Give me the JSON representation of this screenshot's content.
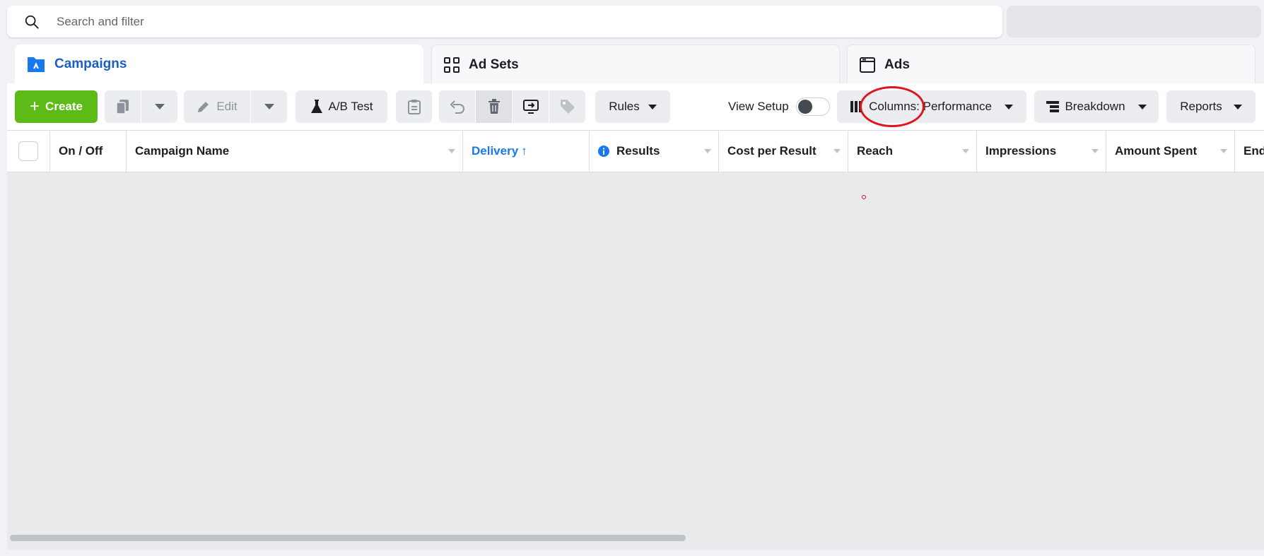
{
  "search": {
    "placeholder": "Search and filter"
  },
  "tabs": [
    {
      "label": "Campaigns",
      "icon": "campaign-folder-icon"
    },
    {
      "label": "Ad Sets",
      "icon": "grid-icon"
    },
    {
      "label": "Ads",
      "icon": "ad-window-icon"
    }
  ],
  "toolbar": {
    "create_label": "Create",
    "edit_label": "Edit",
    "ab_test_label": "A/B Test",
    "rules_label": "Rules",
    "view_setup_label": "View Setup",
    "columns_label": "Columns: Performance",
    "breakdown_label": "Breakdown",
    "reports_label": "Reports"
  },
  "table": {
    "columns": [
      "On / Off",
      "Campaign Name",
      "Delivery",
      "Results",
      "Cost per Result",
      "Reach",
      "Impressions",
      "Amount Spent",
      "Ends"
    ]
  },
  "colors": {
    "accent": "#1877f2",
    "active_tab": "#1b5fc4",
    "create_button": "#5dbb17",
    "annotation": "#e0141e"
  }
}
